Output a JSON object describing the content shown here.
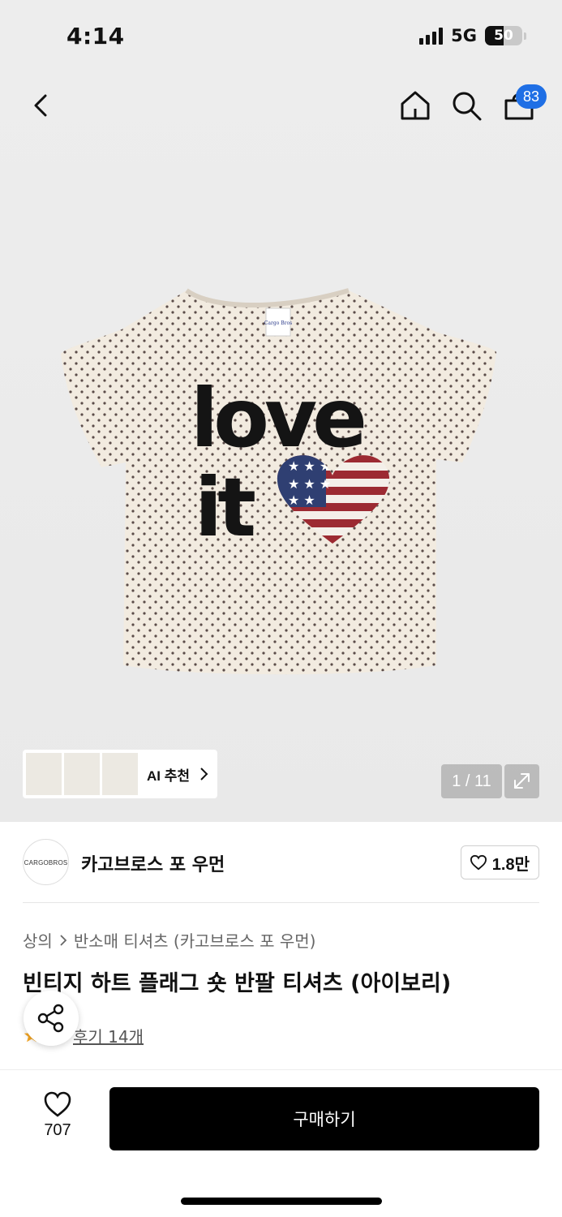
{
  "status_bar": {
    "time": "4:14",
    "network": "5G",
    "battery": "50",
    "battery_level": 0.5,
    "signal_bars": 4
  },
  "nav": {
    "back_icon": "chevron-left-icon",
    "home_icon": "home-icon",
    "search_icon": "search-icon",
    "cart_icon": "shopping-bag-icon",
    "cart_badge": "83",
    "badge_color": "#1f6fe5"
  },
  "product_image": {
    "print_line1": "love",
    "print_line2": "it",
    "label_text": "Cargo Bros"
  },
  "ai_recommend": {
    "label": "AI 추천"
  },
  "gallery": {
    "counter": "1 / 11",
    "expand_icon": "expand-icon"
  },
  "brand": {
    "logo_text": "CARGOBROS",
    "name": "카고브로스 포 우먼",
    "favorite_count": "1.8만"
  },
  "breadcrumb": {
    "category": "상의",
    "subcategory": "반소매 티셔츠 (카고브로스 포 우먼)"
  },
  "product": {
    "title": "빈티지 하트 플래그 숏 반팔 티셔츠 (아이보리)"
  },
  "reviews": {
    "label": "후기 14개",
    "star_color": "#f5a623"
  },
  "bottom_bar": {
    "like_count": "707",
    "buy_label": "구매하기"
  }
}
